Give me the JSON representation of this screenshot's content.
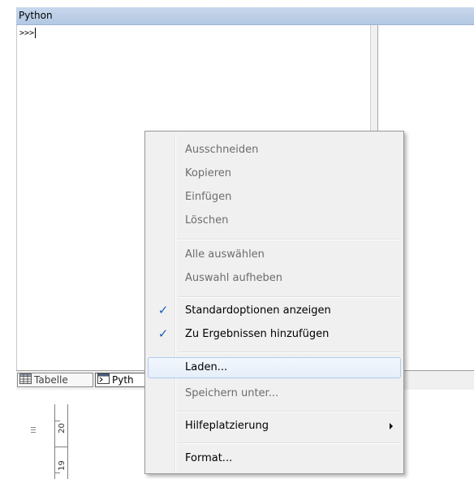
{
  "panel": {
    "title": "Python",
    "prompt": ">>>"
  },
  "tabs": [
    {
      "label": "Tabelle"
    },
    {
      "label": "Pyth"
    }
  ],
  "ruler": {
    "labels": [
      "20",
      "19"
    ]
  },
  "context_menu": {
    "items": [
      {
        "label": "Ausschneiden"
      },
      {
        "label": "Kopieren"
      },
      {
        "label": "Einfügen"
      },
      {
        "label": "Löschen"
      },
      {
        "label": "Alle auswählen"
      },
      {
        "label": "Auswahl aufheben"
      },
      {
        "label": "Standardoptionen anzeigen",
        "checked": true
      },
      {
        "label": "Zu Ergebnissen hinzufügen",
        "checked": true
      },
      {
        "label": "Laden..."
      },
      {
        "label": "Speichern unter..."
      },
      {
        "label": "Hilfeplatzierung",
        "submenu": true
      },
      {
        "label": "Format..."
      }
    ]
  },
  "colors": {
    "titlebar": "#c7d7ec",
    "menu_background": "#f0f0f0",
    "menu_hover_border": "#aeccef",
    "check_color": "#1a5fb4",
    "disabled_text": "#6d6d6d"
  },
  "icons": {
    "checkmark": "check-icon",
    "submenu": "submenu-arrow-icon",
    "table_tab": "table-icon",
    "python_tab": "console-icon"
  }
}
